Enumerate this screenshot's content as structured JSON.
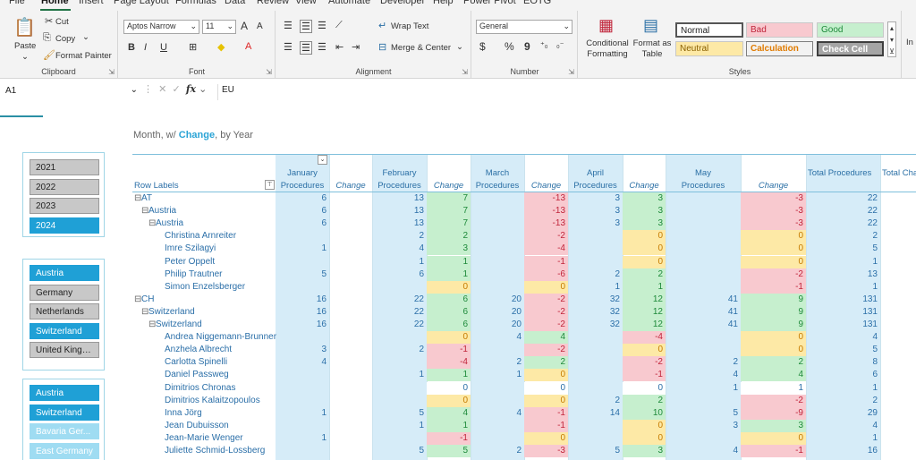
{
  "menu": [
    "File",
    "Home",
    "Insert",
    "Page Layout",
    "Formulas",
    "Data",
    "Review",
    "View",
    "Automate",
    "Developer",
    "Help",
    "Power Pivot",
    "EOTG"
  ],
  "menu_active": "Home",
  "ribbon": {
    "clipboard": {
      "paste": "Paste",
      "cut": "Cut",
      "copy": "Copy",
      "format_painter": "Format Painter",
      "label": "Clipboard"
    },
    "font": {
      "name": "Aptos Narrow",
      "size": "11",
      "bold": "B",
      "italic": "I",
      "underline": "U",
      "label": "Font",
      "grow": "A",
      "shrink": "A"
    },
    "alignment": {
      "wrap": "Wrap Text",
      "merge": "Merge & Center",
      "label": "Alignment"
    },
    "number": {
      "format": "General",
      "currency": "$",
      "percent": "%",
      "comma": "9",
      "label": "Number"
    },
    "styles": {
      "conditional": "Conditional Formatting",
      "format_table": "Format as Table",
      "label": "Styles",
      "cells": [
        "Normal",
        "Bad",
        "Good",
        "Neutral",
        "Calculation",
        "Check Cell"
      ]
    },
    "insert_partial": "In"
  },
  "formula_bar": {
    "cell_ref": "A1",
    "value": "EU",
    "fx": "fx"
  },
  "pivot_title": {
    "prefix": "Month, w/ ",
    "highlight": "Change",
    "suffix": ", by Year"
  },
  "slicers": {
    "years": [
      {
        "label": "2021",
        "state": "off"
      },
      {
        "label": "2022",
        "state": "off"
      },
      {
        "label": "2023",
        "state": "off"
      },
      {
        "label": "2024",
        "state": "on"
      }
    ],
    "countries": [
      {
        "label": "Austria",
        "state": "on"
      },
      {
        "label": "Germany",
        "state": "off"
      },
      {
        "label": "Netherlands",
        "state": "off"
      },
      {
        "label": "Switzerland",
        "state": "on"
      },
      {
        "label": "United Kingd...",
        "state": "off"
      }
    ],
    "regions": [
      {
        "label": "Austria",
        "state": "on"
      },
      {
        "label": "Switzerland",
        "state": "on"
      },
      {
        "label": "Bavaria Ger...",
        "state": "light"
      },
      {
        "label": "East Germany",
        "state": "light"
      }
    ]
  },
  "pivot": {
    "row_labels": "Row Labels",
    "headers": [
      {
        "top": "January",
        "bottom": "Procedures"
      },
      {
        "top": "",
        "bottom": "Change"
      },
      {
        "top": "February",
        "bottom": "Procedures"
      },
      {
        "top": "",
        "bottom": "Change"
      },
      {
        "top": "March",
        "bottom": "Procedures"
      },
      {
        "top": "",
        "bottom": "Change"
      },
      {
        "top": "April",
        "bottom": "Procedures"
      },
      {
        "top": "",
        "bottom": "Change"
      },
      {
        "top": "May",
        "bottom": "Procedures"
      },
      {
        "top": "",
        "bottom": "Change"
      },
      {
        "top": "",
        "bottom": "Total Procedures"
      },
      {
        "top": "",
        "bottom": "Total Cha"
      }
    ],
    "rows": [
      {
        "label": "AT",
        "level": 0,
        "exp": "⊟",
        "v": [
          "6",
          "",
          "13",
          "7",
          "",
          "-13",
          "3",
          "3",
          "",
          "-3",
          "22"
        ],
        "c": [
          "",
          "",
          "",
          "g",
          "",
          "r",
          "",
          "g",
          "",
          "r",
          ""
        ]
      },
      {
        "label": "Austria",
        "level": 1,
        "exp": "⊟",
        "v": [
          "6",
          "",
          "13",
          "7",
          "",
          "-13",
          "3",
          "3",
          "",
          "-3",
          "22"
        ],
        "c": [
          "",
          "",
          "",
          "g",
          "",
          "r",
          "",
          "g",
          "",
          "r",
          ""
        ]
      },
      {
        "label": "Austria",
        "level": 2,
        "exp": "⊟",
        "v": [
          "6",
          "",
          "13",
          "7",
          "",
          "-13",
          "3",
          "3",
          "",
          "-3",
          "22"
        ],
        "c": [
          "",
          "",
          "",
          "g",
          "",
          "r",
          "",
          "g",
          "",
          "r",
          ""
        ]
      },
      {
        "label": "Christina Arnreiter",
        "level": 3,
        "exp": "",
        "v": [
          "",
          "",
          "2",
          "2",
          "",
          "-2",
          "",
          "0",
          "",
          "0",
          "2"
        ],
        "c": [
          "",
          "",
          "",
          "g",
          "",
          "r",
          "",
          "y",
          "",
          "y",
          ""
        ]
      },
      {
        "label": "Imre Szilagyi",
        "level": 3,
        "exp": "",
        "v": [
          "1",
          "",
          "4",
          "3",
          "",
          "-4",
          "",
          "0",
          "",
          "0",
          "5"
        ],
        "c": [
          "",
          "",
          "",
          "g",
          "",
          "r",
          "",
          "y",
          "",
          "y",
          ""
        ]
      },
      {
        "label": "Peter Oppelt",
        "level": 3,
        "exp": "",
        "v": [
          "",
          "",
          "1",
          "1",
          "",
          "-1",
          "",
          "0",
          "",
          "0",
          "1"
        ],
        "c": [
          "",
          "",
          "",
          "g",
          "",
          "r",
          "",
          "y",
          "",
          "y",
          ""
        ]
      },
      {
        "label": "Philip Trautner",
        "level": 3,
        "exp": "",
        "v": [
          "5",
          "",
          "6",
          "1",
          "",
          "-6",
          "2",
          "2",
          "",
          "-2",
          "13"
        ],
        "c": [
          "",
          "",
          "",
          "g",
          "",
          "r",
          "",
          "g",
          "",
          "r",
          ""
        ]
      },
      {
        "label": "Simon Enzelsberger",
        "level": 3,
        "exp": "",
        "v": [
          "",
          "",
          "",
          "0",
          "",
          "0",
          "1",
          "1",
          "",
          "-1",
          "1"
        ],
        "c": [
          "",
          "",
          "",
          "y",
          "",
          "y",
          "",
          "g",
          "",
          "r",
          ""
        ]
      },
      {
        "label": "CH",
        "level": 0,
        "exp": "⊟",
        "v": [
          "16",
          "",
          "22",
          "6",
          "20",
          "-2",
          "32",
          "12",
          "41",
          "9",
          "131"
        ],
        "c": [
          "",
          "",
          "",
          "g",
          "",
          "r",
          "",
          "g",
          "",
          "g",
          ""
        ]
      },
      {
        "label": "Switzerland",
        "level": 1,
        "exp": "⊟",
        "v": [
          "16",
          "",
          "22",
          "6",
          "20",
          "-2",
          "32",
          "12",
          "41",
          "9",
          "131"
        ],
        "c": [
          "",
          "",
          "",
          "g",
          "",
          "r",
          "",
          "g",
          "",
          "g",
          ""
        ]
      },
      {
        "label": "Switzerland",
        "level": 2,
        "exp": "⊟",
        "v": [
          "16",
          "",
          "22",
          "6",
          "20",
          "-2",
          "32",
          "12",
          "41",
          "9",
          "131"
        ],
        "c": [
          "",
          "",
          "",
          "g",
          "",
          "r",
          "",
          "g",
          "",
          "g",
          ""
        ]
      },
      {
        "label": "Andrea Niggemann-Brunner",
        "level": 3,
        "exp": "",
        "v": [
          "",
          "",
          "",
          "0",
          "4",
          "4",
          "",
          "-4",
          "",
          "0",
          "4"
        ],
        "c": [
          "",
          "",
          "",
          "y",
          "",
          "g",
          "",
          "r",
          "",
          "y",
          ""
        ]
      },
      {
        "label": "Anzhela Albrecht",
        "level": 3,
        "exp": "",
        "v": [
          "3",
          "",
          "2",
          "-1",
          "",
          "-2",
          "",
          "0",
          "",
          "0",
          "5"
        ],
        "c": [
          "",
          "",
          "",
          "r",
          "",
          "r",
          "",
          "y",
          "",
          "y",
          ""
        ]
      },
      {
        "label": "Carlotta Spinelli",
        "level": 3,
        "exp": "",
        "v": [
          "4",
          "",
          "",
          "-4",
          "2",
          "2",
          "",
          "-2",
          "2",
          "2",
          "8"
        ],
        "c": [
          "",
          "",
          "",
          "r",
          "",
          "g",
          "",
          "r",
          "",
          "g",
          ""
        ]
      },
      {
        "label": "Daniel Passweg",
        "level": 3,
        "exp": "",
        "v": [
          "",
          "",
          "1",
          "1",
          "1",
          "0",
          "",
          "-1",
          "4",
          "4",
          "6"
        ],
        "c": [
          "",
          "",
          "",
          "g",
          "",
          "y",
          "",
          "r",
          "",
          "g",
          ""
        ]
      },
      {
        "label": "Dimitrios Chronas",
        "level": 3,
        "exp": "",
        "v": [
          "",
          "",
          "",
          "0",
          "",
          "0",
          "",
          "0",
          "1",
          "1",
          "1"
        ],
        "c": [
          "",
          "",
          "",
          "w",
          "",
          "w",
          "",
          "w",
          "",
          "w",
          ""
        ]
      },
      {
        "label": "Dimitrios Kalaitzopoulos",
        "level": 3,
        "exp": "",
        "v": [
          "",
          "",
          "",
          "0",
          "",
          "0",
          "2",
          "2",
          "",
          "-2",
          "2"
        ],
        "c": [
          "",
          "",
          "",
          "y",
          "",
          "y",
          "",
          "g",
          "",
          "r",
          ""
        ]
      },
      {
        "label": "Inna Jörg",
        "level": 3,
        "exp": "",
        "v": [
          "1",
          "",
          "5",
          "4",
          "4",
          "-1",
          "14",
          "10",
          "5",
          "-9",
          "29"
        ],
        "c": [
          "",
          "",
          "",
          "g",
          "",
          "r",
          "",
          "g",
          "",
          "r",
          ""
        ]
      },
      {
        "label": "Jean Dubuisson",
        "level": 3,
        "exp": "",
        "v": [
          "",
          "",
          "1",
          "1",
          "",
          "-1",
          "",
          "0",
          "3",
          "3",
          "4"
        ],
        "c": [
          "",
          "",
          "",
          "g",
          "",
          "r",
          "",
          "y",
          "",
          "g",
          ""
        ]
      },
      {
        "label": "Jean-Marie Wenger",
        "level": 3,
        "exp": "",
        "v": [
          "1",
          "",
          "",
          "-1",
          "",
          "0",
          "",
          "0",
          "",
          "0",
          "1"
        ],
        "c": [
          "",
          "",
          "",
          "r",
          "",
          "y",
          "",
          "y",
          "",
          "y",
          ""
        ]
      },
      {
        "label": "Juliette Schmid-Lossberg",
        "level": 3,
        "exp": "",
        "v": [
          "",
          "",
          "5",
          "5",
          "2",
          "-3",
          "5",
          "3",
          "4",
          "-1",
          "16"
        ],
        "c": [
          "",
          "",
          "",
          "g",
          "",
          "r",
          "",
          "g",
          "",
          "r",
          ""
        ]
      }
    ]
  }
}
